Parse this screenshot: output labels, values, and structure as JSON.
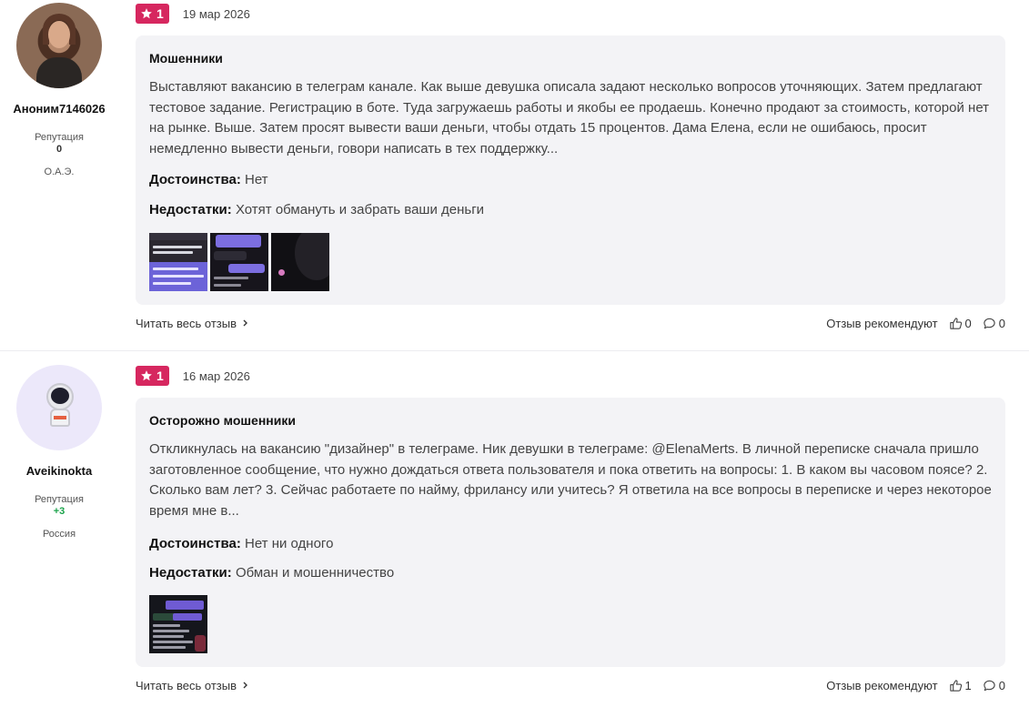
{
  "reviews": [
    {
      "rating": "1",
      "date": "19 мар 2026",
      "author": {
        "nick": "Аноним7146026",
        "reputation_label": "Репутация",
        "reputation_value": "0",
        "city": "О.А.Э."
      },
      "title": "Мошенники",
      "text": "Выставляют вакансию в телеграм канале. Как выше девушка описала задают несколько вопросов уточняющих. Затем предлагают тестовое задание. Регистрацию в боте. Туда загружаешь работы и якобы ее продаешь. Конечно продают за стоимость, которой нет на рынке. Выше. Затем просят вывести ваши деньги, чтобы отдать 15 процентов. Дама Елена, если не ошибаюсь, просит немедленно вывести деньги, говори написать в тех поддержку...",
      "pros_label": "Достоинства:",
      "pros": "Нет",
      "cons_label": "Недостатки:",
      "cons": "Хотят обмануть и забрать ваши деньги",
      "read_more": "Читать весь отзыв",
      "recommend": "Отзыв рекомендуют",
      "likes": "0",
      "comments": "0"
    },
    {
      "rating": "1",
      "date": "16 мар 2026",
      "author": {
        "nick": "Aveikinokta",
        "reputation_label": "Репутация",
        "reputation_value": "+3",
        "city": "Россия"
      },
      "title": "Осторожно мошенники",
      "text": "Откликнулась на вакансию \"дизайнер\" в телеграме. Ник девушки в телеграме: @ElenaMerts. В личной переписке сначала пришло заготовленное сообщение, что нужно дождаться ответа пользователя и пока ответить на вопросы: 1. В каком вы часовом поясе? 2. Сколько вам лет? 3. Сейчас работаете по найму, фрилансу или учитесь? Я ответила на все вопросы в переписке и через некоторое время мне в...",
      "pros_label": "Достоинства:",
      "pros": "Нет ни одного",
      "cons_label": "Недостатки:",
      "cons": "Обман и мошенничество",
      "read_more": "Читать весь отзыв",
      "recommend": "Отзыв рекомендуют",
      "likes": "1",
      "comments": "0"
    }
  ],
  "colors": {
    "rating_badge": "#d6275f",
    "card_bg": "#f3f3f6",
    "positive_rep": "#1aa34a"
  },
  "icons": [
    "star-icon",
    "chevron-right-icon",
    "thumbs-up-icon",
    "comment-icon"
  ]
}
